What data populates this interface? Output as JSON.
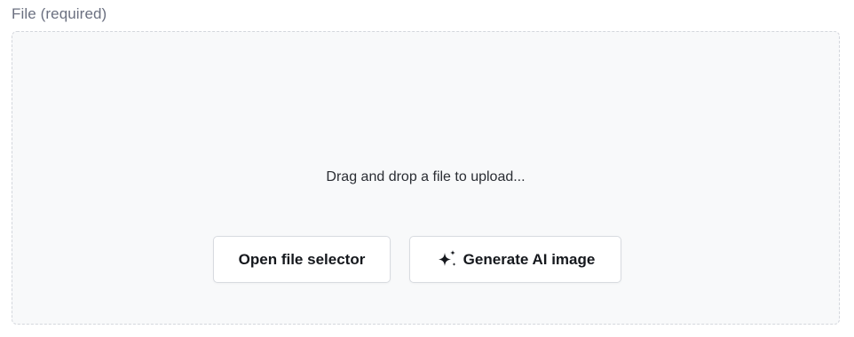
{
  "field": {
    "label": "File (required)"
  },
  "dropzone": {
    "prompt": "Drag and drop a file to upload..."
  },
  "buttons": {
    "open_file_selector": "Open file selector",
    "generate_ai_image": "Generate AI image",
    "generate_ai_image_icon": "sparkles-icon"
  }
}
